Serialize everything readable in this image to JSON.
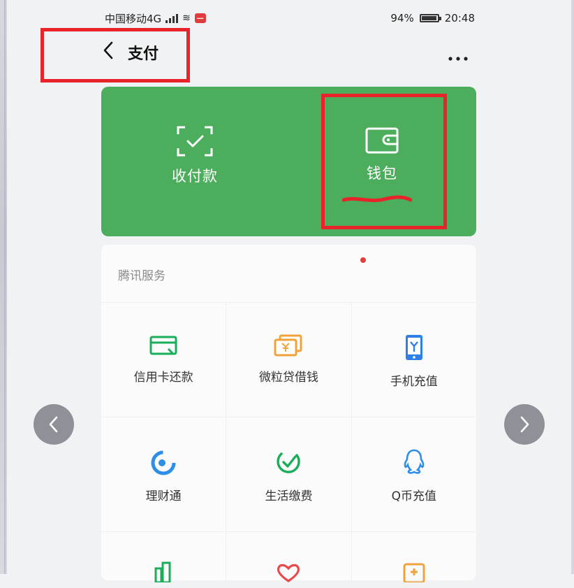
{
  "status_bar": {
    "carrier": "中国移动4G",
    "battery": "94%",
    "time": "20:48"
  },
  "nav": {
    "title": "支付",
    "back_icon": "chevron-left-icon",
    "more_icon": "more-dots-icon"
  },
  "card": {
    "actions": [
      {
        "label": "收付款",
        "icon": "scan-pay-icon"
      },
      {
        "label": "钱包",
        "icon": "wallet-icon"
      }
    ],
    "color": "#4cae5c"
  },
  "services": {
    "title": "腾讯服务",
    "rows": [
      [
        {
          "label": "信用卡还款",
          "icon": "credit-card-icon"
        },
        {
          "label": "微粒贷借钱",
          "icon": "loan-icon"
        },
        {
          "label": "手机充值",
          "icon": "phone-recharge-icon"
        }
      ],
      [
        {
          "label": "理财通",
          "icon": "wealth-icon"
        },
        {
          "label": "生活缴费",
          "icon": "utility-bill-icon"
        },
        {
          "label": "Q币充值",
          "icon": "qq-coin-icon"
        }
      ],
      [
        {
          "icon": "city-services-icon"
        },
        {
          "icon": "charity-icon"
        },
        {
          "icon": "medical-icon"
        }
      ]
    ]
  },
  "colors": {
    "highlight": "#e8232a",
    "accent_green": "#1aad5a",
    "accent_orange": "#f0a33a",
    "accent_blue": "#2f7fe8"
  },
  "arrows": {
    "left_icon": "chevron-left-icon",
    "right_icon": "chevron-right-icon"
  }
}
